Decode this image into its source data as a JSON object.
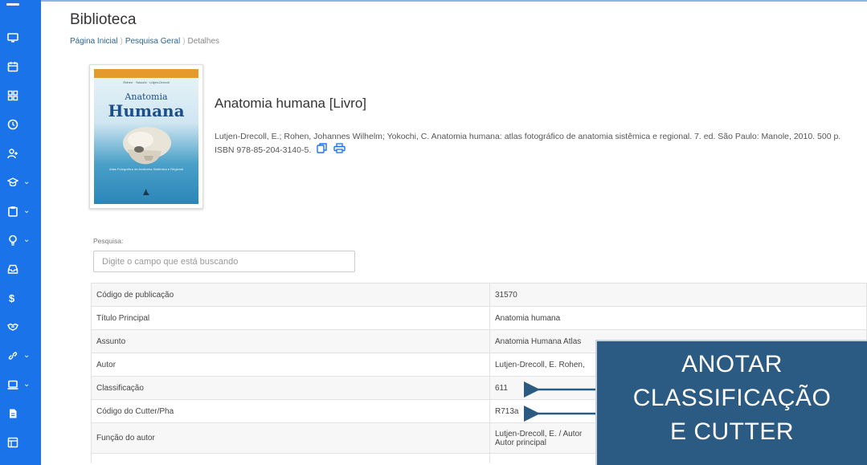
{
  "sidebar": {
    "items": [
      {
        "icon": "monitor-icon",
        "chevron": false
      },
      {
        "icon": "calendar-icon",
        "chevron": false
      },
      {
        "icon": "grid-icon",
        "chevron": false
      },
      {
        "icon": "clock-icon",
        "chevron": false
      },
      {
        "icon": "add-user-icon",
        "chevron": false
      },
      {
        "icon": "graduation-cap-icon",
        "chevron": true
      },
      {
        "icon": "clipboard-icon",
        "chevron": true
      },
      {
        "icon": "lightbulb-icon",
        "chevron": true
      },
      {
        "icon": "inbox-icon",
        "chevron": false
      },
      {
        "icon": "dollar-icon",
        "chevron": false
      },
      {
        "icon": "handshake-icon",
        "chevron": false
      },
      {
        "icon": "link-icon",
        "chevron": true
      },
      {
        "icon": "laptop-icon",
        "chevron": true
      },
      {
        "icon": "document-icon",
        "chevron": false
      },
      {
        "icon": "layout-icon",
        "chevron": false
      }
    ],
    "accent": "#1a73e8"
  },
  "header": {
    "title": "Biblioteca",
    "breadcrumb": [
      "Página Inicial",
      "Pesquisa Geral",
      "Detalhes"
    ]
  },
  "book": {
    "cover": {
      "authors": "Rohen · Yokochi · Lütjen-Drecoll",
      "title_line1": "Anatomia",
      "title_line2": "Humana",
      "subtitle": "Atlas Fotográfico de Anatomia Sistêmica e Regional"
    },
    "title": "Anatomia humana [Livro]",
    "reference": "Lutjen-Drecoll, E.; Rohen, Johannes Wilhelm; Yokochi, C. Anatomia humana: atlas fotográfico de anatomia sistêmica e regional. 7. ed. São Paulo: Manole, 2010. 500 p. ISBN 978-85-204-3140-5."
  },
  "search": {
    "label": "Pesquisa:",
    "placeholder": "Digite o campo que está buscando",
    "value": ""
  },
  "details": {
    "rows": [
      {
        "field": "Código de publicação",
        "value": "31570"
      },
      {
        "field": "Título Principal",
        "value": "Anatomia humana"
      },
      {
        "field": "Assunto",
        "value": "Anatomia Humana Atlas"
      },
      {
        "field": "Autor",
        "value": "Lutjen-Drecoll, E. Rohen,"
      },
      {
        "field": "Classificação",
        "value": "611"
      },
      {
        "field": "Código do Cutter/Pha",
        "value": "R713a"
      },
      {
        "field": "Função do autor",
        "value": "Lutjen-Drecoll, E. / Autor",
        "value2": "Autor principal"
      }
    ]
  },
  "callout": {
    "lines": [
      "ANOTAR",
      "CLASSIFICAÇÃO",
      "E CUTTER"
    ],
    "color": "#2b5a82"
  }
}
